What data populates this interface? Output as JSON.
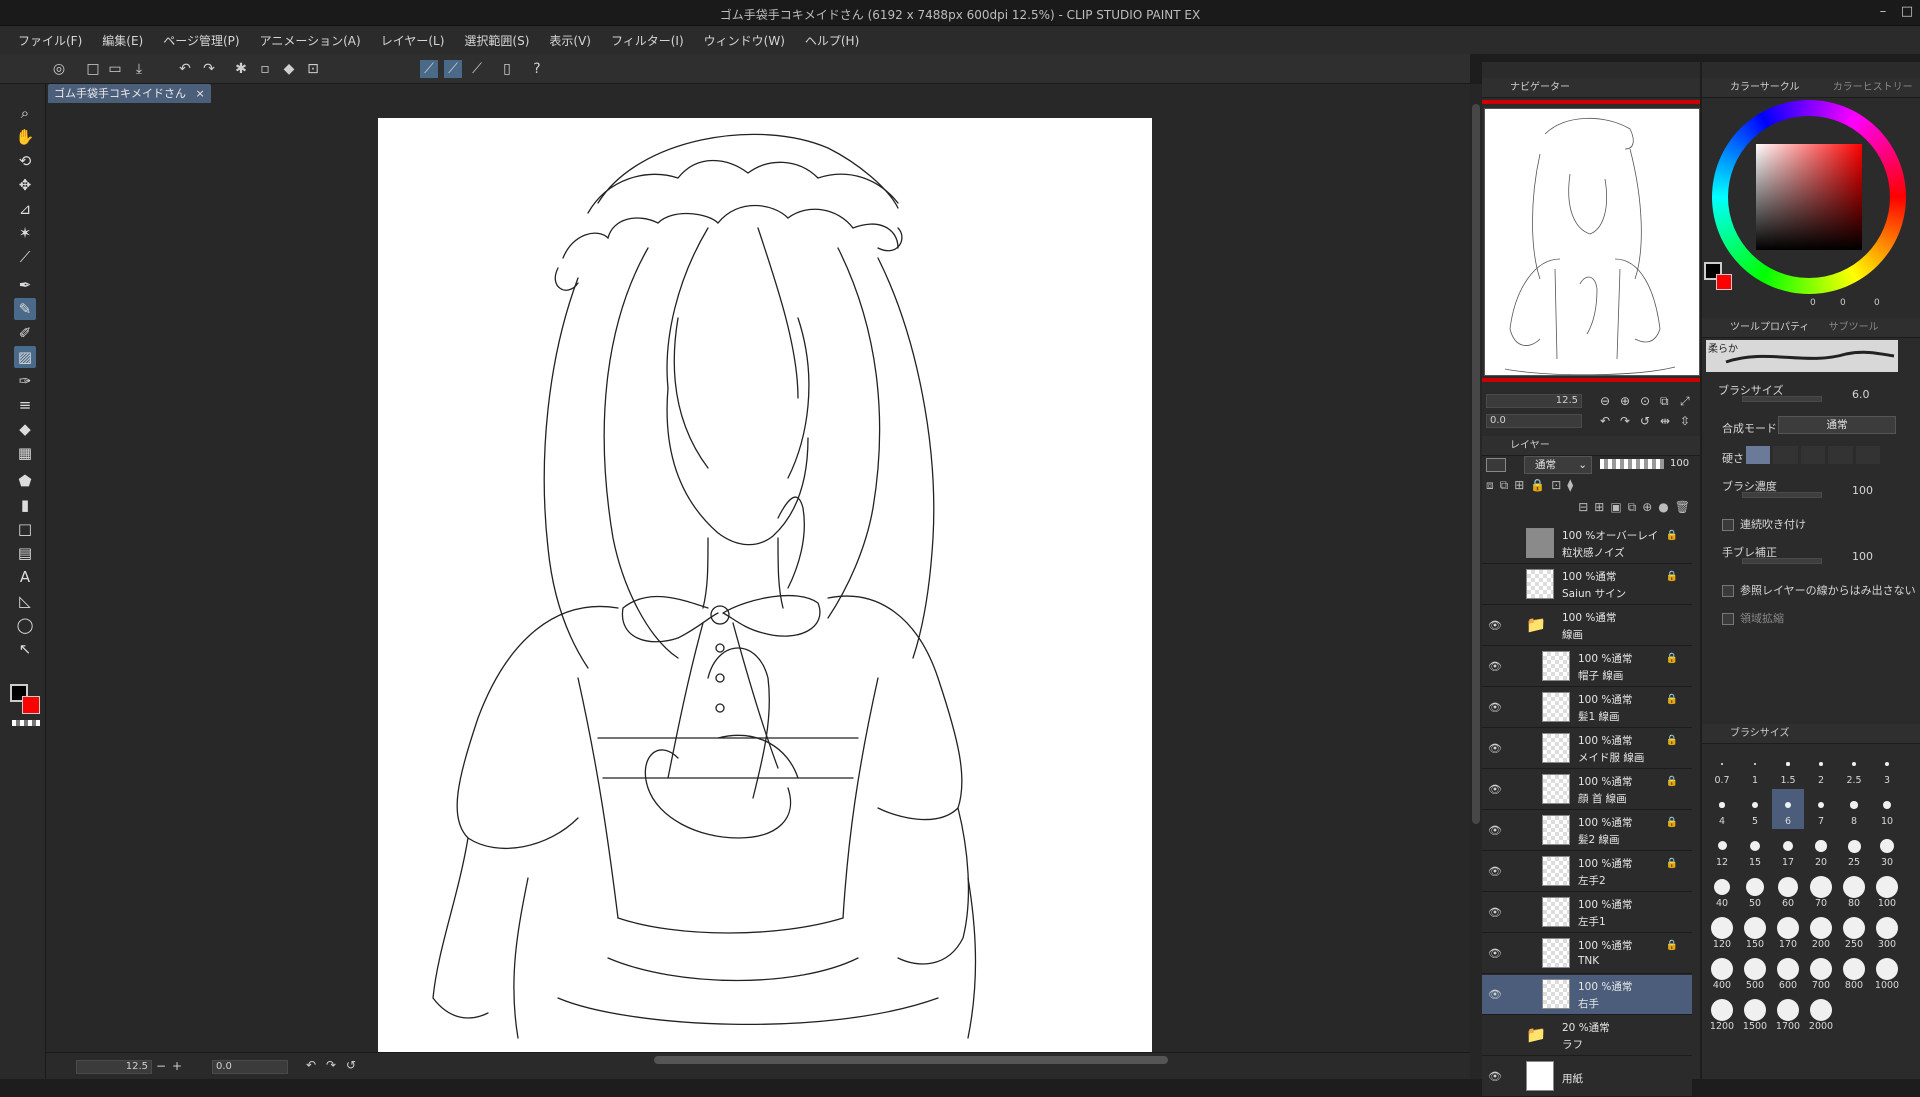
{
  "window": {
    "title": "ゴム手袋手コキメイドさん (6192 x 7488px 600dpi 12.5%) - CLIP STUDIO PAINT EX",
    "controls": [
      "–",
      "□"
    ]
  },
  "menu": [
    "ファイル(F)",
    "編集(E)",
    "ページ管理(P)",
    "アニメーション(A)",
    "レイヤー(L)",
    "選択範囲(S)",
    "表示(V)",
    "フィルター(I)",
    "ウィンドウ(W)",
    "ヘルプ(H)"
  ],
  "document_tab": {
    "label": "ゴム手袋手コキメイドさん",
    "close": "×"
  },
  "statusbar": {
    "zoom": "12.5",
    "angle": "0.0",
    "minus": "−",
    "plus": "+"
  },
  "navigator": {
    "title": "ナビゲーター",
    "zoom": "12.5",
    "angle": "0.0"
  },
  "color": {
    "tab_wheel": "カラーサークル",
    "tab_history": "カラーヒストリー",
    "values": [
      "0",
      "0",
      "0"
    ],
    "main_color": "#000000",
    "sub_color": "#ff0000"
  },
  "tool_property": {
    "tab": "ツールプロパティ",
    "tab_sub": "サブツール",
    "preset_name": "柔らか",
    "brush_size_label": "ブラシサイズ",
    "brush_size_value": "6.0",
    "blend_label": "合成モード",
    "blend_value": "通常",
    "hardness_label": "硬さ",
    "density_label": "ブラシ濃度",
    "density_value": "100",
    "continuous_label": "連続吹き付け",
    "stabilize_label": "手ブレ補正",
    "stabilize_value": "100",
    "ref_layer_label": "参照レイヤーの線からはみ出さない",
    "area_label": "領域拡縮"
  },
  "brush_size_panel": {
    "title": "ブラシサイズ",
    "sizes": [
      "0.7",
      "1",
      "1.5",
      "2",
      "2.5",
      "3",
      "4",
      "5",
      "6",
      "7",
      "8",
      "10",
      "12",
      "15",
      "17",
      "20",
      "25",
      "30",
      "40",
      "50",
      "60",
      "70",
      "80",
      "100",
      "120",
      "150",
      "170",
      "200",
      "250",
      "300",
      "400",
      "500",
      "600",
      "700",
      "800",
      "1000",
      "1200",
      "1500",
      "1700",
      "2000"
    ],
    "selected": "6"
  },
  "layer_panel": {
    "title": "レイヤー",
    "blend": "通常",
    "opacity": "100",
    "layers": [
      {
        "mode": "100 %オーバーレイ",
        "name": "粒状感ノイズ",
        "indent": 0,
        "visible": false,
        "locked": true,
        "type": "gray"
      },
      {
        "mode": "100 %通常",
        "name": "Saiun サイン",
        "indent": 0,
        "visible": false,
        "locked": true,
        "type": "trans"
      },
      {
        "mode": "100 %通常",
        "name": "線画",
        "indent": 0,
        "visible": true,
        "locked": false,
        "type": "folder"
      },
      {
        "mode": "100 %通常",
        "name": "帽子 線画",
        "indent": 1,
        "visible": true,
        "locked": true,
        "type": "trans"
      },
      {
        "mode": "100 %通常",
        "name": "髪1 線画",
        "indent": 1,
        "visible": true,
        "locked": true,
        "type": "trans"
      },
      {
        "mode": "100 %通常",
        "name": "メイド服 線画",
        "indent": 1,
        "visible": true,
        "locked": true,
        "type": "trans"
      },
      {
        "mode": "100 %通常",
        "name": "顔 首 線画",
        "indent": 1,
        "visible": true,
        "locked": true,
        "type": "trans"
      },
      {
        "mode": "100 %通常",
        "name": "髪2 線画",
        "indent": 1,
        "visible": true,
        "locked": true,
        "type": "trans"
      },
      {
        "mode": "100 %通常",
        "name": "左手2",
        "indent": 1,
        "visible": true,
        "locked": true,
        "type": "trans"
      },
      {
        "mode": "100 %通常",
        "name": "左手1",
        "indent": 1,
        "visible": true,
        "locked": false,
        "type": "trans"
      },
      {
        "mode": "100 %通常",
        "name": "TNK",
        "indent": 1,
        "visible": true,
        "locked": true,
        "type": "trans"
      },
      {
        "mode": "100 %通常",
        "name": "右手",
        "indent": 1,
        "visible": true,
        "locked": false,
        "type": "trans",
        "selected": true
      },
      {
        "mode": "20 %通常",
        "name": "ラフ",
        "indent": 0,
        "visible": false,
        "locked": false,
        "type": "folder"
      },
      {
        "mode": "",
        "name": "用紙",
        "indent": 0,
        "visible": true,
        "locked": false,
        "type": "paper"
      }
    ]
  },
  "tools": [
    "zoom-icon",
    "hand-icon",
    "rotate-icon",
    "move-icon",
    "operation-icon",
    "auto-select-icon",
    "eyedropper-icon",
    "pen-icon",
    "pencil-icon",
    "brush-icon",
    "airbrush-icon",
    "decoration-icon",
    "eraser-icon",
    "blend-icon",
    "fill-icon",
    "gradient-icon",
    "figure-icon",
    "frame-icon",
    "text-icon",
    "balloon-icon",
    "lasso-icon",
    "correct-line-icon"
  ]
}
